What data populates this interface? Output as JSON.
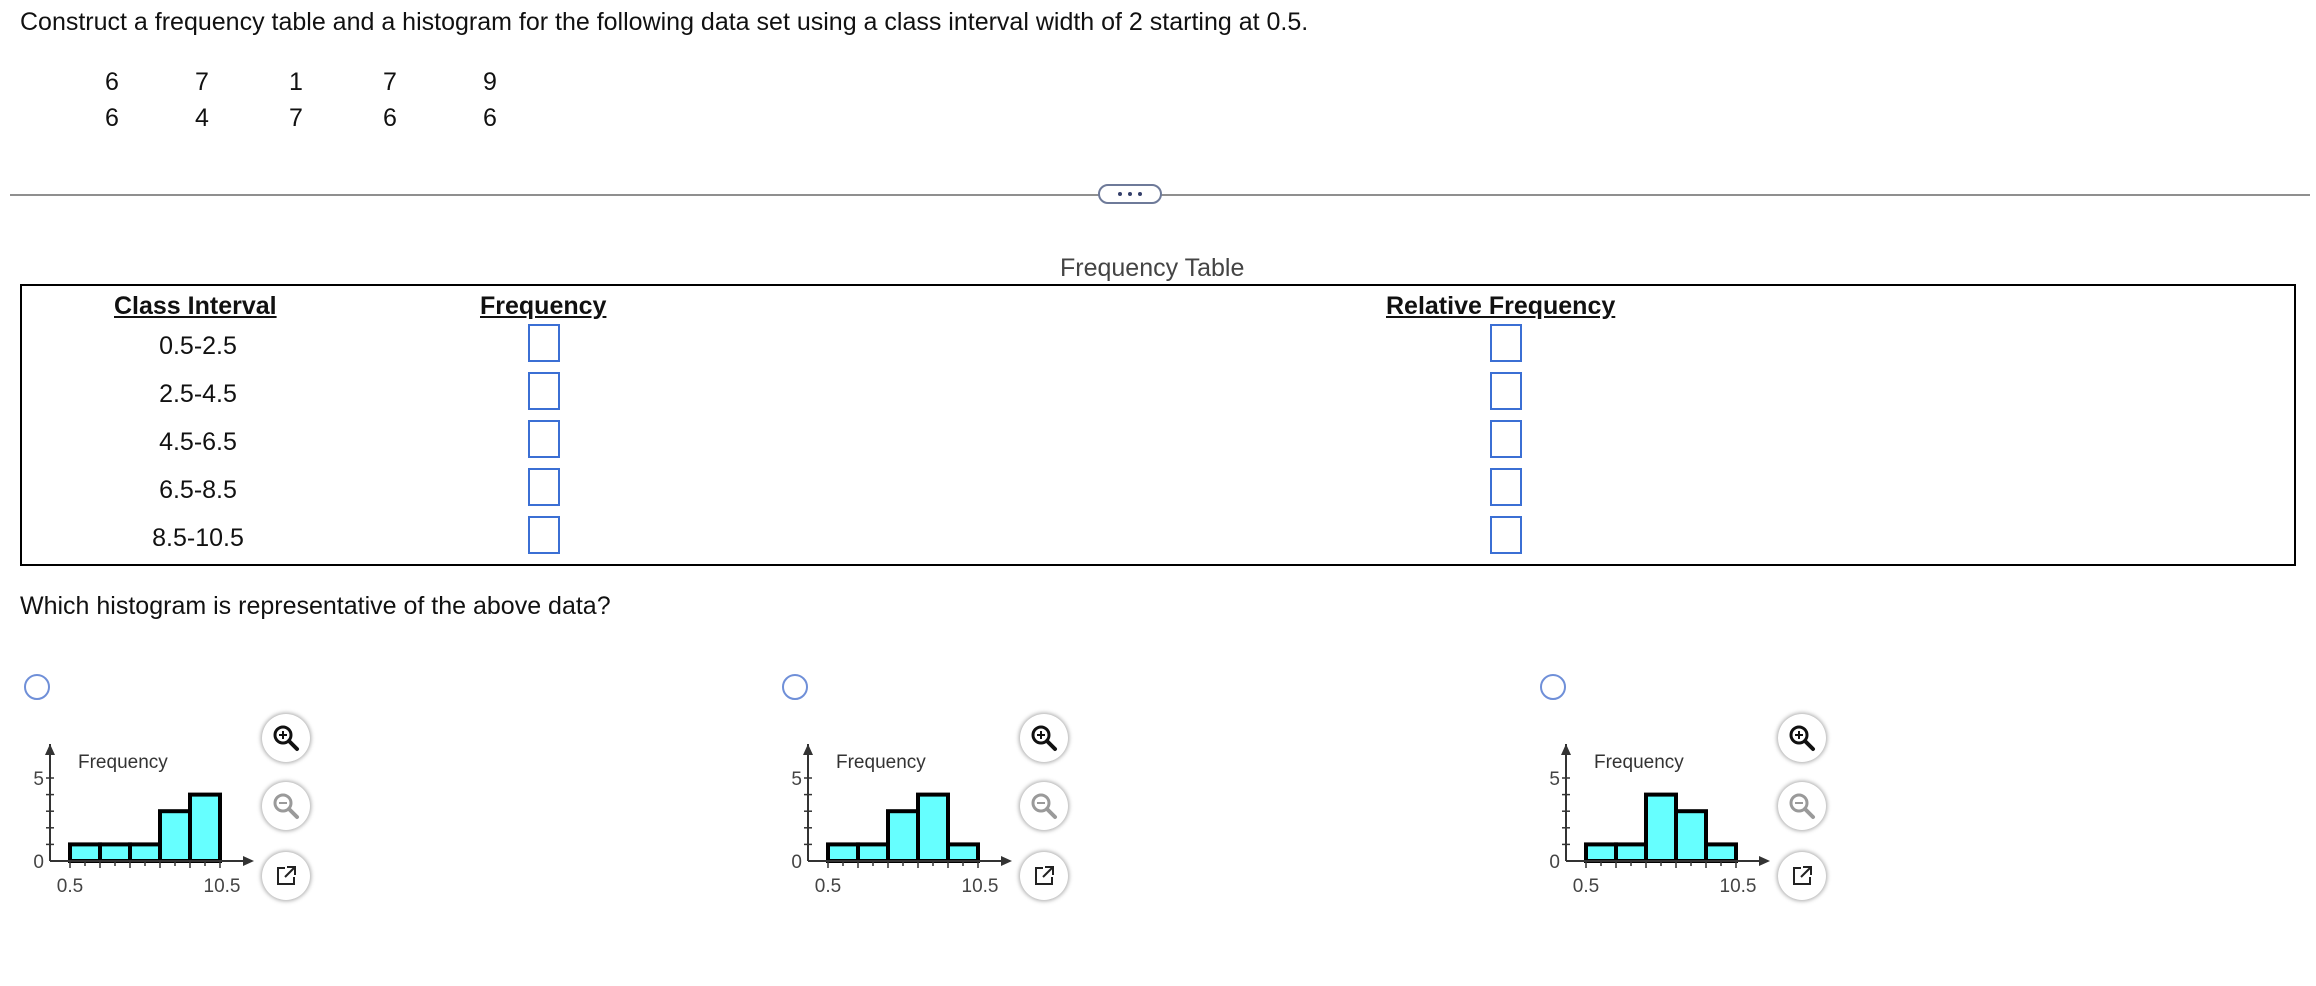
{
  "question": {
    "text": "Construct a frequency table and a histogram for the following data set using a class interval width of 2 starting at 0.5."
  },
  "data_set": {
    "rows": [
      [
        "6",
        "7",
        "1",
        "7",
        "9"
      ],
      [
        "6",
        "4",
        "7",
        "6",
        "6"
      ]
    ]
  },
  "frequency_table": {
    "caption": "Frequency Table",
    "headers": {
      "class_interval": "Class Interval",
      "frequency": "Frequency",
      "relative_frequency": "Relative Frequency"
    },
    "intervals": [
      "0.5-2.5",
      "2.5-4.5",
      "4.5-6.5",
      "6.5-8.5",
      "8.5-10.5"
    ],
    "frequency_values": [
      "",
      "",
      "",
      "",
      ""
    ],
    "relative_frequency_values": [
      "",
      "",
      "",
      "",
      ""
    ]
  },
  "histogram_question": {
    "prompt": "Which histogram is representative of the above data?"
  },
  "histogram_options": [
    {
      "ylabel": "Frequency",
      "x_start": "0.5",
      "x_end": "10.5",
      "y_ticks": [
        "0",
        "5"
      ],
      "bins": [
        1,
        1,
        1,
        3,
        4
      ],
      "selected": false
    },
    {
      "ylabel": "Frequency",
      "x_start": "0.5",
      "x_end": "10.5",
      "y_ticks": [
        "0",
        "5"
      ],
      "bins": [
        1,
        1,
        3,
        4,
        1
      ],
      "selected": false
    },
    {
      "ylabel": "Frequency",
      "x_start": "0.5",
      "x_end": "10.5",
      "y_ticks": [
        "0",
        "5"
      ],
      "bins": [
        1,
        1,
        4,
        3,
        1
      ],
      "selected": false
    }
  ],
  "chart_data": [
    {
      "type": "bar",
      "categories": [
        "0.5-2.5",
        "2.5-4.5",
        "4.5-6.5",
        "6.5-8.5",
        "8.5-10.5"
      ],
      "values": [
        1,
        1,
        1,
        3,
        4
      ],
      "ylabel": "Frequency",
      "ylim": [
        0,
        5
      ]
    },
    {
      "type": "bar",
      "categories": [
        "0.5-2.5",
        "2.5-4.5",
        "4.5-6.5",
        "6.5-8.5",
        "8.5-10.5"
      ],
      "values": [
        1,
        1,
        3,
        4,
        1
      ],
      "ylabel": "Frequency",
      "ylim": [
        0,
        5
      ]
    },
    {
      "type": "bar",
      "categories": [
        "0.5-2.5",
        "2.5-4.5",
        "4.5-6.5",
        "6.5-8.5",
        "8.5-10.5"
      ],
      "values": [
        1,
        1,
        4,
        3,
        1
      ],
      "ylabel": "Frequency",
      "ylim": [
        0,
        5
      ]
    }
  ],
  "colors": {
    "bar_fill": "#66ffff",
    "answer_box_border": "#3b6fd4",
    "radio_border": "#6f8fd8"
  },
  "icons": {
    "zoom_in": "zoom-in-icon",
    "zoom_out": "zoom-out-icon",
    "popout": "popout-icon",
    "more": "ellipsis-icon"
  }
}
